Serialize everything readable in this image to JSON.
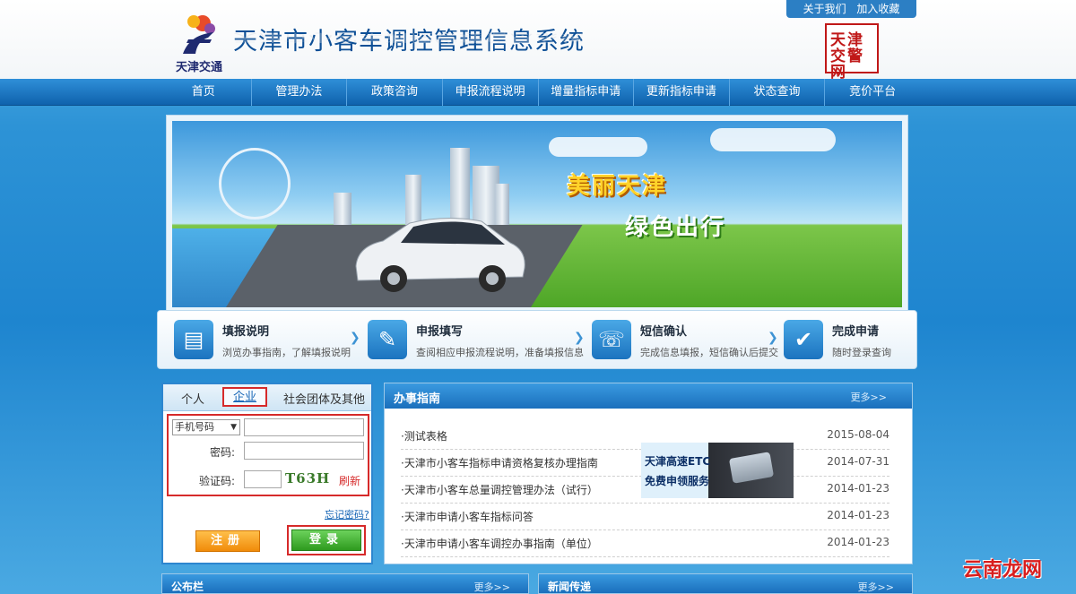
{
  "header": {
    "logo_text": "天津交通",
    "site_title": "天津市小客车调控管理信息系统",
    "top_links": [
      "关于我们",
      "加入收藏"
    ],
    "seal_text": "天津交警网"
  },
  "nav": {
    "items": [
      "首页",
      "管理办法",
      "政策咨询",
      "申报流程说明",
      "增量指标申请",
      "更新指标申请",
      "状态查询",
      "竞价平台"
    ]
  },
  "banner": {
    "line1": "美丽天津",
    "line2": "绿色出行"
  },
  "steps": [
    {
      "title": "填报说明",
      "desc": "浏览办事指南，了解填报说明",
      "icon": "document-icon"
    },
    {
      "title": "申报填写",
      "desc": "查阅相应申报流程说明，准备填报信息",
      "icon": "edit-form-icon"
    },
    {
      "title": "短信确认",
      "desc": "完成信息填报，短信确认后提交",
      "icon": "mobile-phone-icon"
    },
    {
      "title": "完成申请",
      "desc": "随时登录查询",
      "icon": "checkmark-icon"
    }
  ],
  "login": {
    "tabs": [
      "个人",
      "企业",
      "社会团体及其他"
    ],
    "active_tab": "企业",
    "phone_select": "手机号码",
    "password_label": "密码:",
    "captcha_label": "验证码:",
    "captcha_text": "T63H",
    "refresh_label": "刷新",
    "forgot_label": "忘记密码?",
    "register_label": "注册",
    "login_label": "登录"
  },
  "guide": {
    "title": "办事指南",
    "more": "更多>>",
    "items": [
      {
        "title": "·测试表格",
        "date": "2015-08-04"
      },
      {
        "title": "·天津市小客车指标申请资格复核办理指南",
        "date": "2014-07-31"
      },
      {
        "title": "·天津市小客车总量调控管理办法（试行）",
        "date": "2014-01-23"
      },
      {
        "title": "·天津市申请小客车指标问答",
        "date": "2014-01-23"
      },
      {
        "title": "·天津市申请小客车调控办事指南（单位）",
        "date": "2014-01-23"
      }
    ],
    "ad": {
      "line1": "天津高速ETC",
      "line2": "免费申领服务"
    }
  },
  "bottom": {
    "notice_title": "公布栏",
    "news_title": "新闻传递",
    "more": "更多>>"
  },
  "watermark": "云南龙网",
  "colors": {
    "nav_blue": "#1565b5",
    "highlight_red": "#d62a2a",
    "register_orange": "#f08b0a",
    "login_green": "#2e9a1e"
  }
}
